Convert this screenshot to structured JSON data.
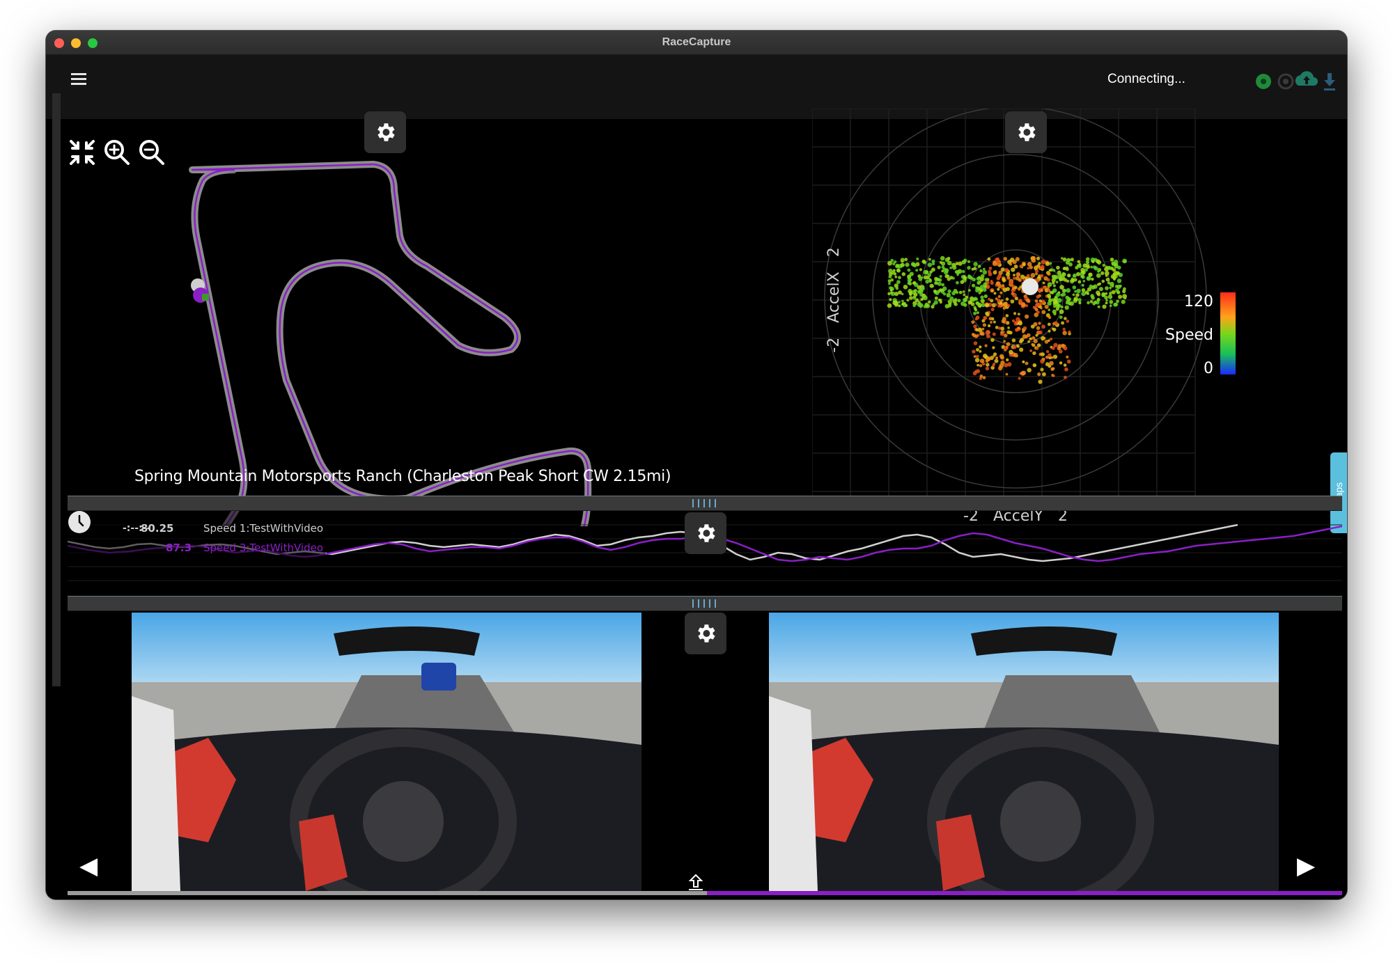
{
  "window": {
    "title": "RaceCapture"
  },
  "appbar": {
    "status": "Connecting..."
  },
  "track_map": {
    "name": "Spring Mountain Motorsports Ranch (Charleston Peak Short CW 2.15mi)",
    "controls": [
      "collapse-icon",
      "zoom-in-icon",
      "zoom-out-icon",
      "gear-icon"
    ]
  },
  "gg_plot": {
    "y_axis": {
      "label": "AccelX",
      "min": "-2",
      "max": "2"
    },
    "x_axis": {
      "label": "AccelY",
      "min": "-2",
      "max": "2"
    },
    "colorbar": {
      "label": "Speed",
      "max": "120",
      "min": "0"
    }
  },
  "speed_chart": {
    "time_readout": "-:--:--",
    "series": [
      {
        "value": "80.25",
        "name": "Speed 1:TestWithVideo",
        "color": "#d0d0d0"
      },
      {
        "value": "87.3",
        "name": "Speed 3:TestWithVideo",
        "color": "#8a1fc6"
      }
    ]
  },
  "laps_tab": {
    "label": "Laps"
  },
  "video": {
    "nav_prev": "◀",
    "nav_next": "▶",
    "progress": 0.5
  },
  "colors": {
    "accent_purple": "#8a1fc6",
    "laps_tab": "#5bc0de",
    "status_green": "#1f8a3a"
  }
}
